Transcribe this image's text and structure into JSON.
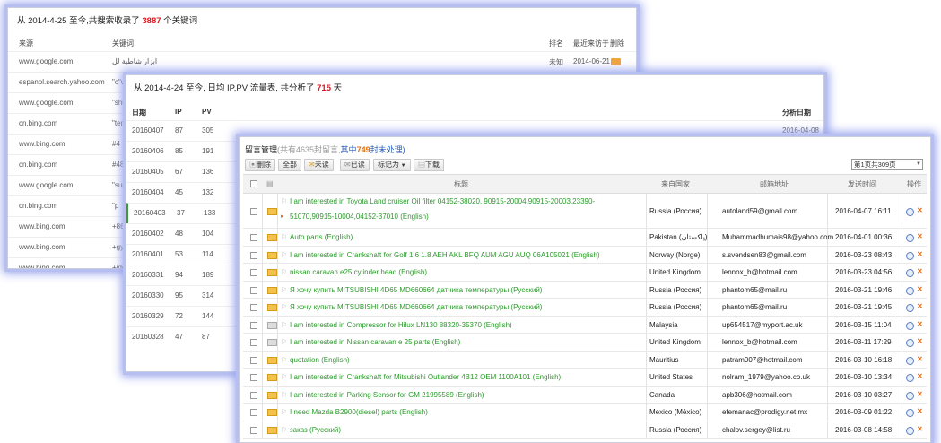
{
  "panel1": {
    "title_prefix": "从 2014-4-25 至今,共搜索收录了",
    "title_count": "3887",
    "title_suffix": "个关键词",
    "headers": {
      "source": "来源",
      "keyword": "关键词",
      "rank": "排名",
      "last_visit": "最近来访于",
      "action": "删除"
    },
    "rows": [
      {
        "source": "www.google.com",
        "keyword": "ابزار شاطبة لل",
        "rank": "未知",
        "date": "2014-06-21"
      },
      {
        "source": "espanol.search.yahoo.com",
        "keyword": "\"c\"v\"",
        "rank": "",
        "date": ""
      },
      {
        "source": "www.google.com",
        "keyword": "\"shu",
        "rank": "",
        "date": ""
      },
      {
        "source": "cn.bing.com",
        "keyword": "\"tem",
        "rank": "",
        "date": ""
      },
      {
        "source": "www.bing.com",
        "keyword": "#4",
        "rank": "",
        "date": ""
      },
      {
        "source": "cn.bing.com",
        "keyword": "#482",
        "rank": "",
        "date": ""
      },
      {
        "source": "www.google.com",
        "keyword": "\"sun",
        "rank": "",
        "date": ""
      },
      {
        "source": "cn.bing.com",
        "keyword": "\"p",
        "rank": "",
        "date": ""
      },
      {
        "source": "www.bing.com",
        "keyword": "+86",
        "rank": "",
        "date": ""
      },
      {
        "source": "www.bing.com",
        "keyword": "+gy",
        "rank": "",
        "date": ""
      },
      {
        "source": "www.bing.com",
        "keyword": "+ide",
        "rank": "",
        "date": ""
      }
    ]
  },
  "panel2": {
    "title_prefix": "从 2014-4-24 至今, 日均 IP,PV 流量表, 共分析了",
    "title_count": "715",
    "title_suffix": "天",
    "headers": {
      "date": "日期",
      "ip": "IP",
      "pv": "PV",
      "analyzed": "分析日期"
    },
    "analyzed_date": "2016-04-08",
    "rows": [
      {
        "date": "20160407",
        "ip": "87",
        "pv": "305"
      },
      {
        "date": "20160406",
        "ip": "85",
        "pv": "191"
      },
      {
        "date": "20160405",
        "ip": "67",
        "pv": "136"
      },
      {
        "date": "20160404",
        "ip": "45",
        "pv": "132"
      },
      {
        "date": "20160403",
        "ip": "37",
        "pv": "133"
      },
      {
        "date": "20160402",
        "ip": "48",
        "pv": "104"
      },
      {
        "date": "20160401",
        "ip": "53",
        "pv": "114"
      },
      {
        "date": "20160331",
        "ip": "94",
        "pv": "189"
      },
      {
        "date": "20160330",
        "ip": "95",
        "pv": "314"
      },
      {
        "date": "20160329",
        "ip": "72",
        "pv": "144"
      },
      {
        "date": "20160328",
        "ip": "47",
        "pv": "87"
      }
    ]
  },
  "panel3": {
    "title": "留言管理",
    "title_grey": "(共有4635封留言,",
    "title_blue1": "其中",
    "title_count": "749",
    "title_blue2": "封未处理)",
    "toolbar": {
      "delete": "删除",
      "all": "全部",
      "unread": "未读",
      "read": "已读",
      "mark_as": "标记为",
      "download": "下载"
    },
    "pager": "第1页共309页",
    "headers": {
      "subject": "标题",
      "country": "来自国家",
      "email": "邮箱地址",
      "sent": "发送时间",
      "action": "操作"
    },
    "messages": [
      {
        "subject": "I am interested in Toyota Land cruiser Oil filter 04152-38020, 90915-20004,90915-20003,23390-",
        "subject2": "51070,90915-10004,04152-37010   (English)",
        "country": "Russia (Россия)",
        "email": "autoland59@gmail.com",
        "date": "2016-04-07 16:11",
        "tall": true
      },
      {
        "subject": "Auto parts   (English)",
        "country": "Pakistan (پاکستان)",
        "email": "Muhammadhumais98@yahoo.com",
        "date": "2016-04-01 00:36"
      },
      {
        "subject": "I am interested in Crankshaft for Golf 1.6 1.8 AEH AKL BFQ AUM AGU AUQ 06A105021   (English)",
        "country": "Norway (Norge)",
        "email": "s.svendsen83@gmail.com",
        "date": "2016-03-23 08:43"
      },
      {
        "subject": "nissan caravan e25 cylinder head   (English)",
        "country": "United Kingdom",
        "email": "lennox_b@hotmail.com",
        "date": "2016-03-23 04:56"
      },
      {
        "subject": "Я хочу купить MITSUBISHI 4D65 MD660664 датчика температуры   (Русский)",
        "country": "Russia (Россия)",
        "email": "phantom65@mail.ru",
        "date": "2016-03-21 19:46"
      },
      {
        "subject": "Я хочу купить MITSUBISHI 4D65 MD660664 датчика температуры   (Русский)",
        "country": "Russia (Россия)",
        "email": "phantom65@mail.ru",
        "date": "2016-03-21 19:45"
      },
      {
        "subject": "I am interested in Compressor for Hilux LN130 88320-35370   (English)",
        "country": "Malaysia",
        "email": "up654517@myport.ac.uk",
        "date": "2016-03-15 11:04",
        "read": true
      },
      {
        "subject": "I am interested in Nissan caravan e 25 parts   (English)",
        "country": "United Kingdom",
        "email": "lennox_b@hotmail.com",
        "date": "2016-03-11 17:29",
        "read": true
      },
      {
        "subject": "quotation   (English)",
        "country": "Mauritius",
        "email": "patram007@hotmail.com",
        "date": "2016-03-10 16:18"
      },
      {
        "subject": "I am interested in Crankshaft for Mitsubishi Outlander 4B12 OEM 1100A101   (English)",
        "country": "United States",
        "email": "nolram_1979@yahoo.co.uk",
        "date": "2016-03-10 13:34"
      },
      {
        "subject": "I am interested in Parking Sensor for GM 21995589   (English)",
        "country": "Canada",
        "email": "apb306@hotmail.com",
        "date": "2016-03-10 03:27"
      },
      {
        "subject": "I need Mazda B2900(diesel) parts   (English)",
        "country": "Mexico (México)",
        "email": "efemanac@prodigy.net.mx",
        "date": "2016-03-09 01:22"
      },
      {
        "subject": "заказ   (Русский)",
        "country": "Russia (Россия)",
        "email": "chalov.sergey@list.ru",
        "date": "2016-03-08 14:58"
      }
    ]
  }
}
